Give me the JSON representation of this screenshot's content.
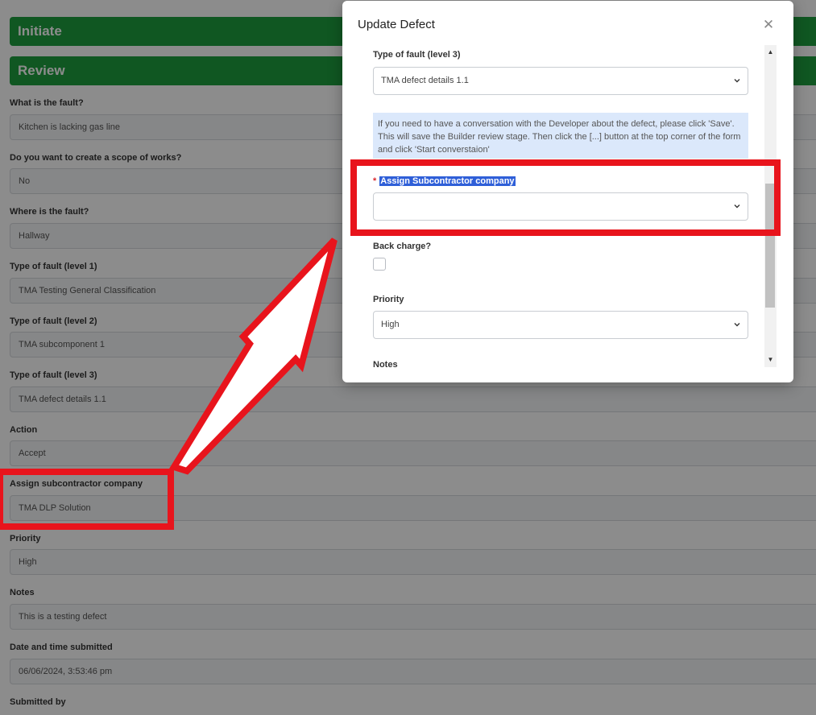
{
  "background": {
    "stages": [
      {
        "label": "Initiate"
      },
      {
        "label": "Review"
      }
    ],
    "fields": [
      {
        "label": "What is the fault?",
        "value": "Kitchen is lacking gas line"
      },
      {
        "label": "Do you want to create a scope of works?",
        "value": "No"
      },
      {
        "label": "Where is the fault?",
        "value": "Hallway"
      },
      {
        "label": "Type of fault (level 1)",
        "value": "TMA Testing General Classification"
      },
      {
        "label": "Type of fault (level 2)",
        "value": "TMA subcomponent 1"
      },
      {
        "label": "Type of fault (level 3)",
        "value": "TMA defect details 1.1"
      },
      {
        "label": "Action",
        "value": "Accept"
      },
      {
        "label": "Assign subcontractor company",
        "value": "TMA DLP Solution"
      },
      {
        "label": "Priority",
        "value": "High"
      },
      {
        "label": "Notes",
        "value": "This is a testing defect"
      },
      {
        "label": "Date and time submitted",
        "value": "06/06/2024, 3:53:46 pm"
      },
      {
        "label": "Submitted by",
        "value": ""
      }
    ]
  },
  "modal": {
    "title": "Update Defect",
    "close_icon": "close-icon",
    "fault_level3": {
      "label": "Type of fault (level 3)",
      "value": "TMA defect details 1.1"
    },
    "info_text": "If you need to have a conversation with the Developer about the defect, please click 'Save'. This will save the Builder review stage. Then click the [...] button at the top corner of the form and click 'Start converstaion'",
    "assign_company": {
      "label": "Assign Subcontractor company",
      "required": "*",
      "value": ""
    },
    "back_charge": {
      "label": "Back charge?",
      "checked": false
    },
    "priority": {
      "label": "Priority",
      "value": "High"
    },
    "notes": {
      "label": "Notes"
    }
  },
  "colors": {
    "stage_green": "#1e9e3e",
    "annotation_red": "#e8141c",
    "info_blue": "#dbe8fb",
    "selection_blue": "#2f5fd8"
  }
}
